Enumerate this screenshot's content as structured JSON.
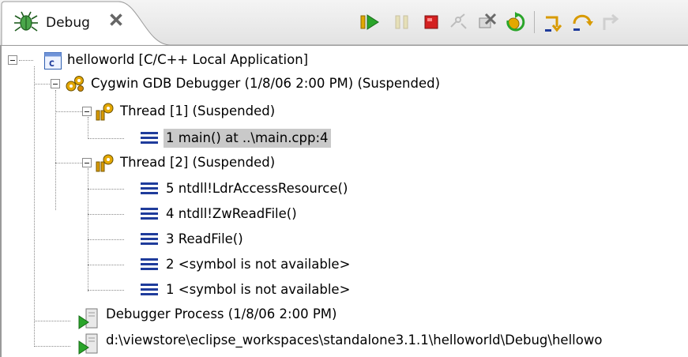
{
  "view": {
    "tab_title": "Debug",
    "toolbar": [
      {
        "name": "resume-icon",
        "enabled": true
      },
      {
        "name": "suspend-icon",
        "enabled": false
      },
      {
        "name": "terminate-icon",
        "enabled": true
      },
      {
        "name": "disconnect-icon",
        "enabled": false
      },
      {
        "name": "remove-terminated-icon",
        "enabled": true
      },
      {
        "name": "restart-icon",
        "enabled": true
      },
      {
        "name": "step-into-icon",
        "enabled": true
      },
      {
        "name": "step-over-icon",
        "enabled": true
      },
      {
        "name": "step-return-icon",
        "enabled": false
      }
    ]
  },
  "tree": {
    "launch": "helloworld [C/C++ Local Application]",
    "debugger": "Cygwin GDB Debugger (1/8/06 2:00 PM) (Suspended)",
    "thread1": {
      "label": "Thread [1] (Suspended)",
      "frames": [
        "1 main() at ..\\main.cpp:4"
      ]
    },
    "thread2": {
      "label": "Thread [2] (Suspended)",
      "frames": [
        "5 ntdll!LdrAccessResource()",
        "4 ntdll!ZwReadFile()",
        "3 ReadFile()",
        "2 <symbol is not available>",
        "1 <symbol is not available>"
      ]
    },
    "process1": "Debugger Process (1/8/06 2:00 PM)",
    "process2": "d:\\viewstore\\eclipse_workspaces\\standalone3.1.1\\helloworld\\Debug\\hellowo"
  },
  "colors": {
    "selection": "#c9c9c9",
    "frame_icon": "#1f3c9b",
    "terminate": "#d42020",
    "resume": "#2aa52a",
    "step": "#d89a00"
  }
}
